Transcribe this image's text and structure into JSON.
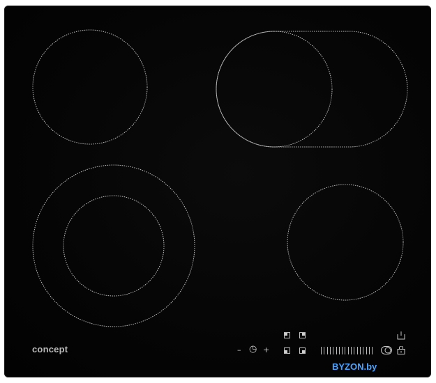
{
  "brand": {
    "logo_text": "concept"
  },
  "cooktop": {
    "zones": [
      {
        "name": "cooking-zone-top-left",
        "type": "single"
      },
      {
        "name": "cooking-zone-top-right",
        "type": "extended-oval"
      },
      {
        "name": "cooking-zone-bottom-left",
        "type": "dual-ring"
      },
      {
        "name": "cooking-zone-bottom-right",
        "type": "single"
      }
    ]
  },
  "controls": {
    "minus": "–",
    "timer": "◷",
    "plus": "+",
    "slider_ticks": 18
  },
  "watermark": {
    "text": "BYZON.by"
  }
}
